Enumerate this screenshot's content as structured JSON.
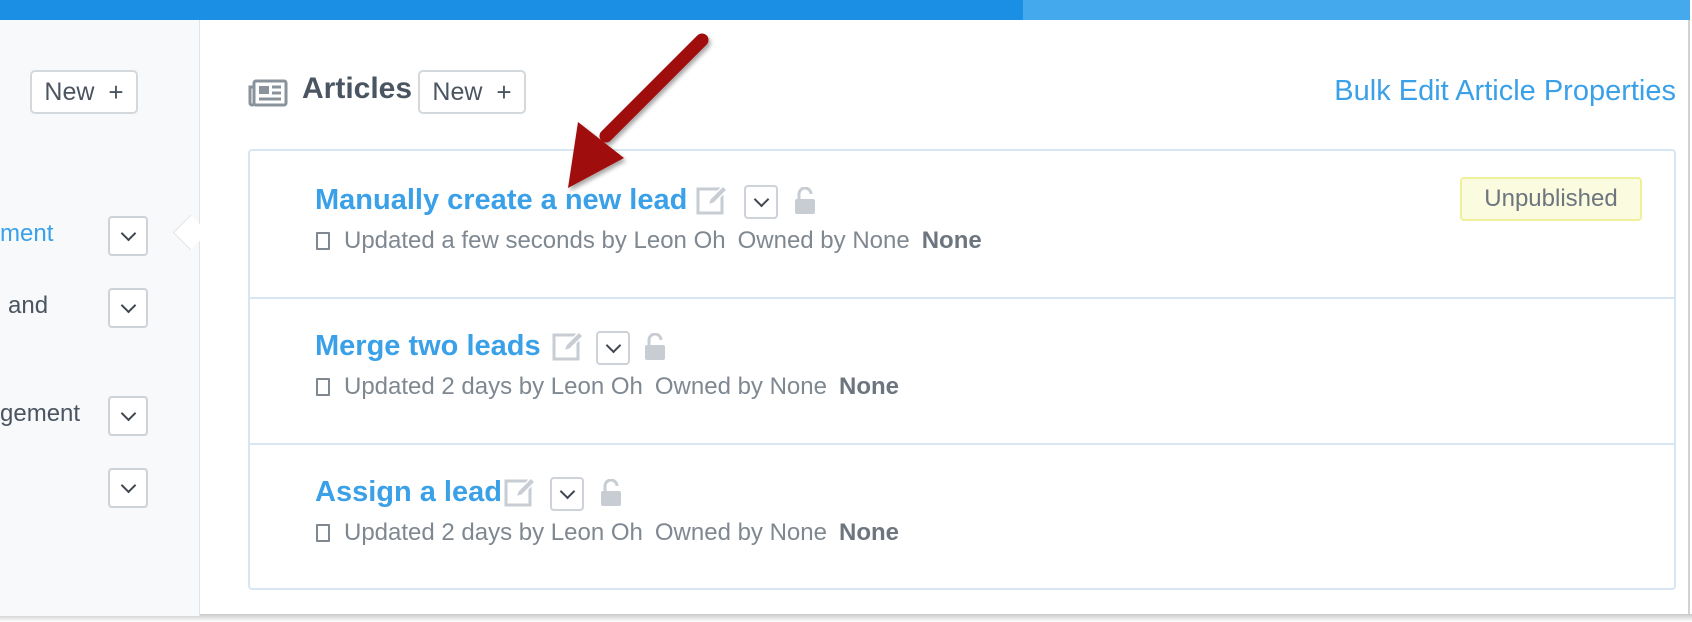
{
  "sidebar": {
    "new_button": "New",
    "new_plus": "+",
    "items": [
      {
        "label": "ment"
      },
      {
        "label": "and"
      },
      {
        "label": "gement"
      },
      {
        "label": ""
      }
    ]
  },
  "header": {
    "title": "Articles",
    "new_button": "New",
    "new_plus": "+",
    "bulk_link": "Bulk Edit Article Properties"
  },
  "articles": [
    {
      "title": "Manually create a new lead",
      "updated": "Updated a few seconds by Leon Oh",
      "owned": "Owned by None",
      "tag": "None",
      "status": "Unpublished"
    },
    {
      "title": "Merge two leads",
      "updated": "Updated 2 days by Leon Oh",
      "owned": "Owned by None",
      "tag": "None"
    },
    {
      "title": "Assign a lead",
      "updated": "Updated 2 days by Leon Oh",
      "owned": "Owned by None",
      "tag": "None"
    }
  ],
  "colors": {
    "accent": "#3aa0e8",
    "topbar_dark": "#1a8fe3",
    "topbar_light": "#45a9ee",
    "annotation_arrow": "#a00d10"
  }
}
